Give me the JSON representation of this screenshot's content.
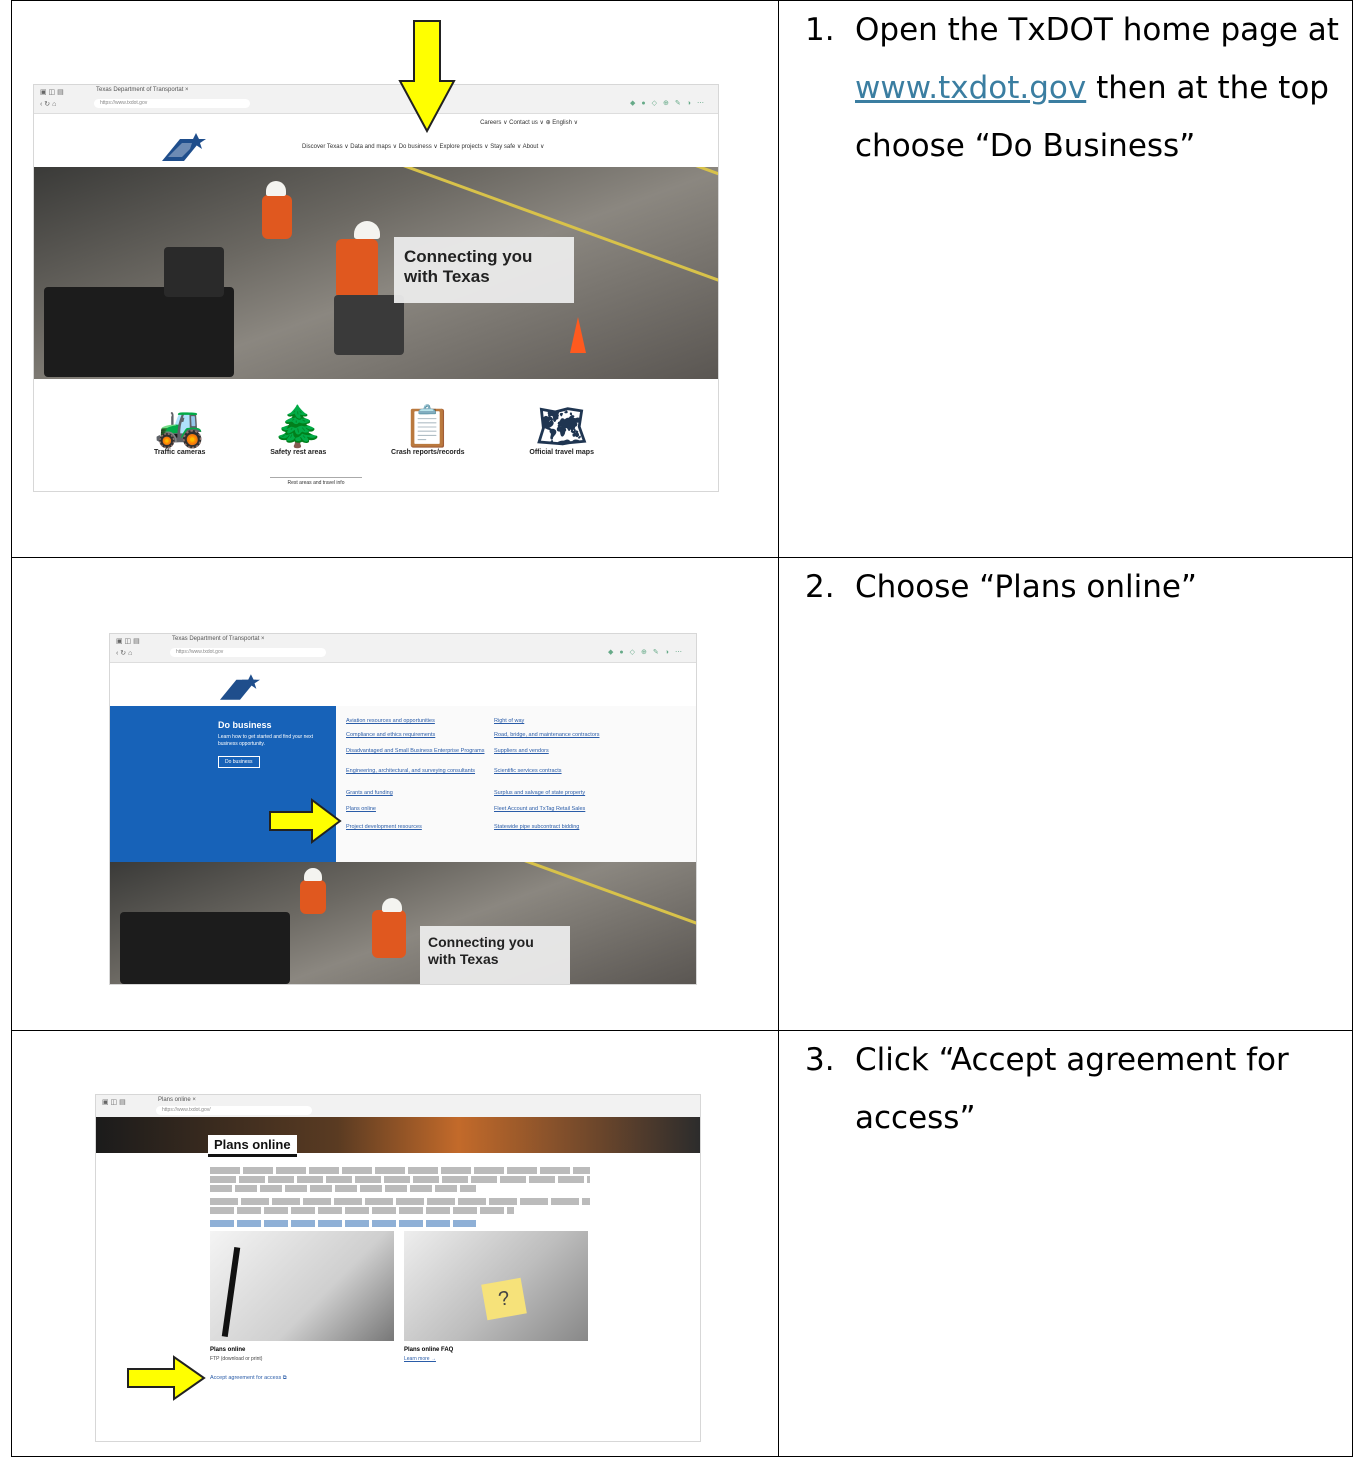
{
  "steps": [
    {
      "number": "1.",
      "text_before": "Open the TxDOT home page at ",
      "link": "www.txdot.gov",
      "text_after": " then at the top choose “Do Business”",
      "shot": {
        "hero_title_1": "Connecting you",
        "hero_title_2": "with Texas",
        "top_links": "Careers ∨     Contact us ∨    ⊕ English ∨",
        "main_nav": "Discover Texas ∨   Data and maps ∨   Do business ∨   Explore projects ∨   Stay safe ∨   About ∨",
        "quick_links": [
          "Traffic cameras",
          "Safety rest areas",
          "Crash reports/records",
          "Official travel maps"
        ],
        "sub_link": "Rest areas and travel info"
      }
    },
    {
      "number": "2.",
      "text_before": "Choose “Plans online”",
      "shot": {
        "menu_heading": "Do business",
        "menu_sub": "Learn how to get started and find your next business opportunity.",
        "menu_button": "Do business",
        "links_col1": [
          "Aviation resources and opportunities",
          "Compliance and ethics requirements",
          "Disadvantaged and Small Business Enterprise Programs",
          "Engineering, architectural, and surveying consultants",
          "Grants and funding",
          "Plans online",
          "Project development resources"
        ],
        "links_col2": [
          "Right of way",
          "Road, bridge, and maintenance contractors",
          "Suppliers and vendors",
          "Scientific services contracts",
          "Surplus and salvage of state property",
          "Fleet Account and TxTag Retail Sales",
          "Statewide pipe subcontract bidding"
        ],
        "hero_title_1": "Connecting you",
        "hero_title_2": "with Texas"
      }
    },
    {
      "number": "3.",
      "text_before": "Click “Accept agreement for access”",
      "shot": {
        "page_title": "Plans online",
        "card1_title": "Plans online",
        "card1_sub": "FTP (download or print)",
        "card2_title": "Plans online FAQ",
        "card2_link": "Learn more →",
        "accept_link": "Accept agreement for access ⧉"
      }
    }
  ],
  "colors": {
    "link": "#3b7ea1",
    "arrow_yellow": "#ffff00",
    "menu_blue": "#1762b8"
  }
}
